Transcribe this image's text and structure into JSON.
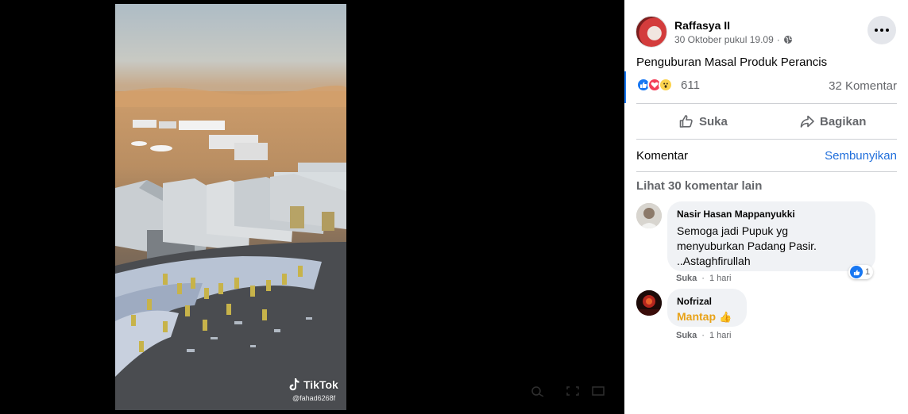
{
  "media": {
    "watermark_label": "TikTok",
    "watermark_handle": "@fahad6268f"
  },
  "post": {
    "author_name": "Raffasya II",
    "timestamp": "30 Oktober pukul 19.09",
    "privacy_icon": "globe-icon",
    "more_icon": "ellipsis-icon",
    "caption": "Penguburan Masal Produk Perancis",
    "reaction_icons": [
      "like-icon",
      "love-icon",
      "wow-icon"
    ],
    "reaction_count": "611",
    "comment_count": "32 Komentar"
  },
  "actions": {
    "like_label": "Suka",
    "share_label": "Bagikan"
  },
  "comments_section": {
    "title": "Komentar",
    "hide_label": "Sembunyikan",
    "view_more_label": "Lihat 30 komentar lain",
    "comments": [
      {
        "author": "Nasir Hasan Mappanyukki",
        "lines": [
          "Semoga jadi Pupuk yg",
          "menyuburkan Padang Pasir.",
          "..Astaghfirullah"
        ],
        "like_label": "Suka",
        "time": "1 hari",
        "reaction_count": "1"
      },
      {
        "author": "Nofrizal",
        "text": "Mantap",
        "emoji": "👍",
        "like_label": "Suka",
        "time": "1 hari"
      }
    ]
  },
  "colors": {
    "accent_blue": "#1877f2",
    "link_blue": "#216fdb",
    "muted_text": "#65676b",
    "bubble_bg": "#f0f2f5",
    "highlight_text": "#e8a217"
  }
}
